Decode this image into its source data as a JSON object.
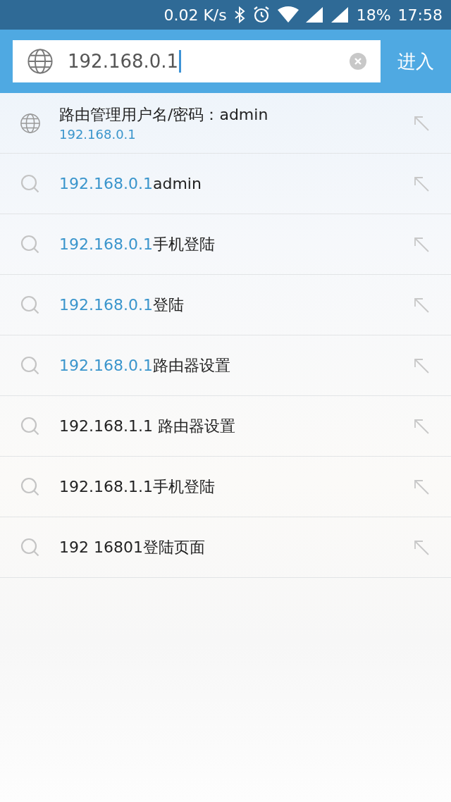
{
  "status_bar": {
    "speed": "0.02 K/s",
    "battery": "18%",
    "time": "17:58"
  },
  "search": {
    "value": "192.168.0.1",
    "button": "进入"
  },
  "suggestions": [
    {
      "kind": "site",
      "title": "路由管理用户名/密码：admin",
      "url": "192.168.0.1"
    },
    {
      "kind": "query",
      "match": "192.168.0.1",
      "rest": "admin"
    },
    {
      "kind": "query",
      "match": "192.168.0.1",
      "rest": "手机登陆"
    },
    {
      "kind": "query",
      "match": "192.168.0.1",
      "rest": "登陆"
    },
    {
      "kind": "query",
      "match": "192.168.0.1",
      "rest": "路由器设置"
    },
    {
      "kind": "query",
      "rest": "192.168.1.1 路由器设置"
    },
    {
      "kind": "query",
      "rest": "192.168.1.1手机登陆"
    },
    {
      "kind": "query",
      "rest": "192 16801登陆页面"
    }
  ]
}
